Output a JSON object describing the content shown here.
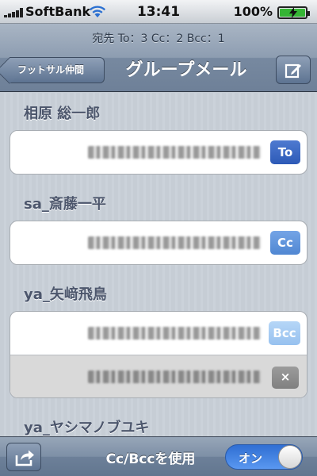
{
  "status_bar": {
    "carrier": "SoftBank",
    "time": "13:41",
    "battery_percent": "100%",
    "battery_level": 1.0,
    "battery_color": "#35b534"
  },
  "nav": {
    "recipient_summary": "宛先 To：3  Cc：2  Bcc：1",
    "back_label": "フットサル仲間",
    "title": "グループメール",
    "compose_icon": "compose-icon"
  },
  "recipients": [
    {
      "name": "相原 総一郎",
      "addresses": [
        {
          "value": "",
          "type": "To",
          "badge_color": "#2d5ab7"
        }
      ]
    },
    {
      "name": "sa_斎藤一平",
      "addresses": [
        {
          "value": "",
          "type": "Cc",
          "badge_color": "#5087d2"
        }
      ]
    },
    {
      "name": "ya_矢﨑飛鳥",
      "addresses": [
        {
          "value": "",
          "type": "Bcc",
          "badge_color": "#97c1ef"
        },
        {
          "value": "",
          "type": "remove",
          "badge_label": "×",
          "disabled": true
        }
      ]
    },
    {
      "name": "ya_ヤシマノブユキ",
      "addresses": []
    }
  ],
  "toolbar": {
    "share_icon": "share-icon",
    "label": "Cc/Bccを使用",
    "toggle_label": "オン",
    "toggle_on": true,
    "toggle_color": "#2f6ed3"
  }
}
